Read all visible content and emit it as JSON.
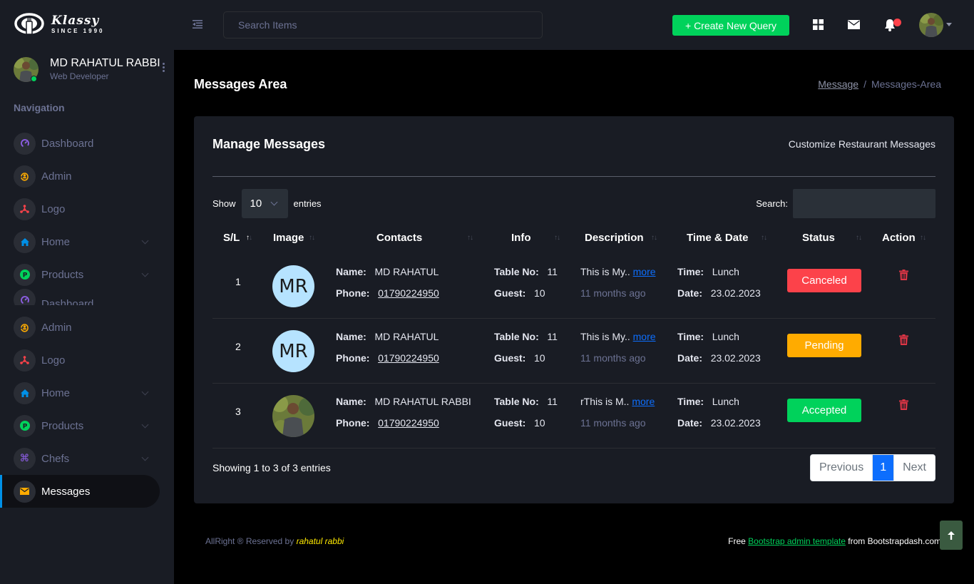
{
  "brand": {
    "name": "Klassy",
    "since": "SINCE 1990"
  },
  "header": {
    "search_placeholder": "Search Items",
    "create_button": "+ Create New Query",
    "icons": [
      "grid-icon",
      "mail-icon",
      "bell-icon",
      "user-avatar"
    ],
    "has_notification": true
  },
  "sidebar": {
    "profile": {
      "name": "MD RAHATUL RABBI",
      "role": "Web Developer",
      "status": "online"
    },
    "heading": "Navigation",
    "items": [
      {
        "label": "Dashboard",
        "icon": "speedometer-icon",
        "icon_color": "#8f5fe8",
        "has_submenu": false,
        "active": false
      },
      {
        "label": "Admin",
        "icon": "admin-icon",
        "icon_color": "#ffab00",
        "has_submenu": false,
        "active": false
      },
      {
        "label": "Logo",
        "icon": "network-icon",
        "icon_color": "#fc424a",
        "has_submenu": false,
        "active": false
      },
      {
        "label": "Home",
        "icon": "home-icon",
        "icon_color": "#0090e7",
        "has_submenu": true,
        "active": false
      },
      {
        "label": "Products",
        "icon": "parking-icon",
        "icon_color": "#00d25b",
        "has_submenu": true,
        "active": false
      },
      {
        "label": "Dashboard",
        "icon": "speedometer-icon",
        "icon_color": "#8f5fe8",
        "has_submenu": false,
        "active": false
      },
      {
        "label": "Admin",
        "icon": "admin-icon",
        "icon_color": "#ffab00",
        "has_submenu": false,
        "active": false
      },
      {
        "label": "Logo",
        "icon": "network-icon",
        "icon_color": "#fc424a",
        "has_submenu": false,
        "active": false
      },
      {
        "label": "Home",
        "icon": "home-icon",
        "icon_color": "#0090e7",
        "has_submenu": true,
        "active": false
      },
      {
        "label": "Products",
        "icon": "parking-icon",
        "icon_color": "#00d25b",
        "has_submenu": true,
        "active": false
      },
      {
        "label": "Chefs",
        "icon": "command-icon",
        "icon_color": "#8f5fe8",
        "has_submenu": true,
        "active": false
      },
      {
        "label": "Messages",
        "icon": "email-icon",
        "icon_color": "#ffab00",
        "has_submenu": false,
        "active": true
      }
    ]
  },
  "page": {
    "title": "Messages Area",
    "breadcrumb": [
      {
        "label": "Message",
        "link": true
      },
      {
        "label": "Messages-Area",
        "link": false
      }
    ]
  },
  "card": {
    "title": "Manage Messages",
    "subtitle": "Customize Restaurant Messages",
    "show_label": "Show",
    "entries_value": "10",
    "entries_label": "entries",
    "search_label": "Search:",
    "search_value": "",
    "columns": [
      "S/L",
      "Image",
      "Contacts",
      "Info",
      "Description",
      "Time & Date",
      "Status",
      "Action"
    ],
    "sorted_column": "S/L",
    "labels": {
      "name": "Name:",
      "phone": "Phone:",
      "table_no": "Table No:",
      "guest": "Guest:",
      "time": "Time:",
      "date": "Date:",
      "more": "more"
    },
    "rows": [
      {
        "sl": "1",
        "avatar_type": "initials",
        "initials": "MR",
        "name": "MD RAHATUL",
        "phone": "01790224950",
        "table_no": "11",
        "guest": "10",
        "description": "This is My..",
        "ago": "11 months ago",
        "time": "Lunch",
        "date": "23.02.2023",
        "status": "Canceled",
        "status_color": "#fc424a"
      },
      {
        "sl": "2",
        "avatar_type": "initials",
        "initials": "MR",
        "name": "MD RAHATUL",
        "phone": "01790224950",
        "table_no": "11",
        "guest": "10",
        "description": "This is My..",
        "ago": "11 months ago",
        "time": "Lunch",
        "date": "23.02.2023",
        "status": "Pending",
        "status_color": "#ffab00"
      },
      {
        "sl": "3",
        "avatar_type": "photo",
        "initials": "",
        "name": "MD RAHATUL RABBI",
        "phone": "01790224950",
        "table_no": "11",
        "guest": "10",
        "description": "rThis is M..",
        "ago": "11 months ago",
        "time": "Lunch",
        "date": "23.02.2023",
        "status": "Accepted",
        "status_color": "#00d25b"
      }
    ],
    "showing_text": "Showing 1 to 3 of 3 entries",
    "pagination": {
      "previous": "Previous",
      "current": "1",
      "next": "Next"
    }
  },
  "footer": {
    "left_prefix": "AllRight ® Reserved by",
    "author": "rahatul rabbi",
    "right_prefix": "Free",
    "right_link": "Bootstrap admin template",
    "right_suffix": "from Bootstrapdash.com"
  }
}
